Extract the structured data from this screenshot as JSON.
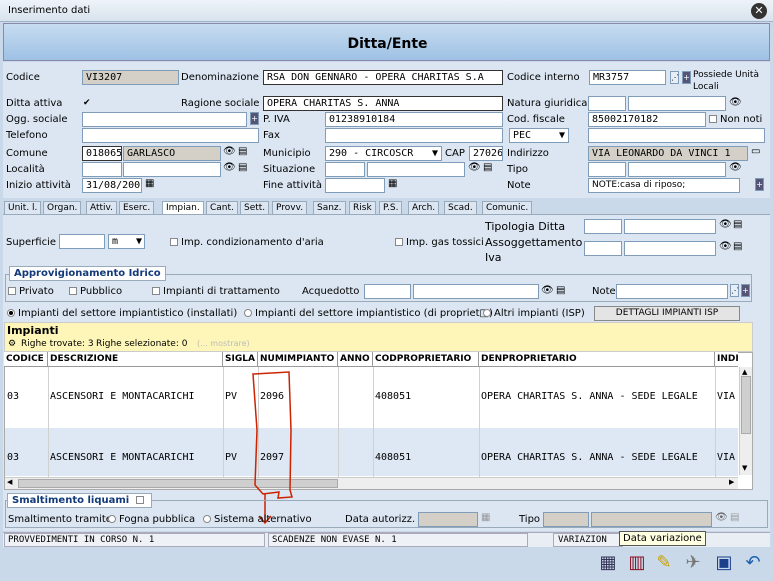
{
  "window": {
    "title": "Inserimento dati"
  },
  "header": {
    "title": "Ditta/Ente"
  },
  "form": {
    "codice_label": "Codice",
    "codice_value": "VI3207",
    "denominazione_label": "Denominazione",
    "denominazione_value": "RSA DON GENNARO - OPERA CHARITAS S.A",
    "codice_interno_label": "Codice interno",
    "codice_interno_value": "MR3757",
    "possiede_label": "Possiede Unità Locali",
    "ditta_attiva_label": "Ditta attiva",
    "ragione_sociale_label": "Ragione sociale",
    "ragione_sociale_value": "OPERA CHARITAS S. ANNA",
    "natura_giuridica_label": "Natura giuridica",
    "ogg_sociale_label": "Ogg. sociale",
    "piva_label": "P. IVA",
    "piva_value": "01238910184",
    "cod_fiscale_label": "Cod. fiscale",
    "cod_fiscale_value": "85002170182",
    "non_noti_label": "Non noti",
    "telefono_label": "Telefono",
    "fax_label": "Fax",
    "pec_value": "PEC",
    "comune_label": "Comune",
    "comune_code": "018065",
    "comune_name": "GARLASCO",
    "municipio_label": "Municipio",
    "municipio_value": "290 - CIRCOSCR",
    "cap_label": "CAP",
    "cap_value": "27026",
    "indirizzo_label": "Indirizzo",
    "indirizzo_value": "VIA LEONARDO DA VINCI 1",
    "localita_label": "Località",
    "situazione_label": "Situazione",
    "tipo_label": "Tipo",
    "inizio_label": "Inizio attività",
    "inizio_value": "31/08/200",
    "fine_label": "Fine attività",
    "note_label": "Note",
    "note_value": "NOTE:casa di riposo;"
  },
  "tabs": [
    "Unit. l.",
    "Organ.",
    "Attiv.",
    "Eserc.",
    "Impian.",
    "Cant.",
    "Sett.",
    "Provv.",
    "Sanz.",
    "Risk",
    "P.S.",
    "Arch.",
    "Scad.",
    "Comunic."
  ],
  "impianti_panel": {
    "superficie_label": "Superficie",
    "unit_value": "m",
    "cond_aria_label": "Imp. condizionamento d'aria",
    "gas_tossici_label": "Imp. gas tossici",
    "tipologia_label": "Tipologia Ditta",
    "assoggettamento_label": "Assoggettamento Iva",
    "approvvigionamento_title": "Approvigionamento Idrico",
    "privato_label": "Privato",
    "pubblico_label": "Pubblico",
    "trattamento_label": "Impianti di trattamento",
    "acquedotto_label": "Acquedotto",
    "note_label": "Note",
    "radio_installati": "Impianti del settore impiantistico (installati)",
    "radio_proprieta": "Impianti del settore impiantistico (di propriet□)",
    "radio_altri": "Altri impianti (ISP)",
    "dettagli_button": "DETTAGLI IMPIANTI ISP"
  },
  "impianti_grid": {
    "title": "Impianti",
    "righe_trovate": "Righe trovate: 3",
    "righe_selezionate": "Righe selezionate: 0",
    "mostrare": "(... mostrare)",
    "columns": [
      "CODICE",
      "DESCRIZIONE",
      "SIGLA",
      "NUMIMPIANTO",
      "ANNO",
      "CODPROPRIETARIO",
      "DENPROPRIETARIO",
      "INDI"
    ],
    "rows": [
      [
        "03",
        "ASCENSORI E MONTACARICHI",
        "PV",
        "2096",
        "",
        "408051",
        "OPERA CHARITAS S. ANNA - SEDE LEGALE",
        "VIA"
      ],
      [
        "03",
        "ASCENSORI E MONTACARICHI",
        "PV",
        "2097",
        "",
        "408051",
        "OPERA CHARITAS S. ANNA - SEDE LEGALE",
        "VIA"
      ]
    ]
  },
  "smaltimento": {
    "title": "Smaltimento liquami",
    "tramite_label": "Smaltimento tramite:",
    "fogna_label": "Fogna pubblica",
    "alternativo_label": "Sistema alternativo",
    "data_autorizz_label": "Data autorizz.",
    "tipo_label": "Tipo"
  },
  "status": {
    "provvedimenti": "PROVVEDIMENTI IN CORSO N. 1",
    "scadenze": "SCADENZE NON EVASE N. 1",
    "variazione": "VARIAZION",
    "tooltip": "Data variazione"
  },
  "colors": {
    "header_bg": "#a8c8e8",
    "grid_title_bg": "#fdf6b8",
    "annotation": "#cc2200"
  }
}
